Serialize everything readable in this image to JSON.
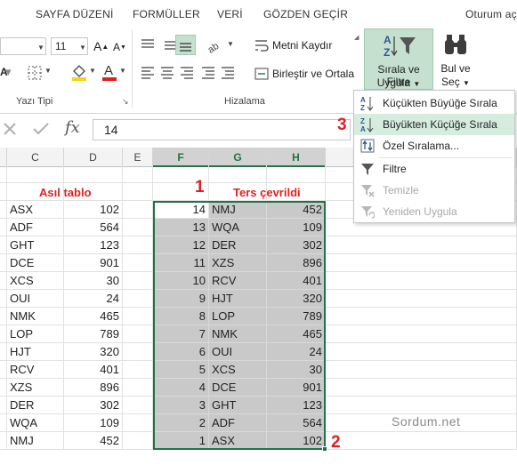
{
  "menu": {
    "tabs": [
      "SAYFA DÜZENİ",
      "FORMÜLLER",
      "VERİ",
      "GÖZDEN GEÇİR"
    ],
    "signin": "Oturum aç"
  },
  "ribbon": {
    "font_size": "11",
    "wrap_text": "Metni Kaydır",
    "merge_center": "Birleştir ve Ortala",
    "sort_filter_line1": "Sırala ve Filtre",
    "sort_filter_line2": "Uygula",
    "find_line1": "Bul ve",
    "find_line2": "Seç",
    "group_font": "Yazı Tipi",
    "group_alignment": "Hizalama"
  },
  "formula": {
    "value": "14",
    "fx": "fx"
  },
  "columns": [
    "C",
    "D",
    "E",
    "F",
    "G",
    "H"
  ],
  "titles": {
    "left": "Asıl tablo",
    "right": "Ters çevrildi"
  },
  "markers": {
    "one": "1",
    "two": "2",
    "three": "3"
  },
  "left_table": [
    {
      "code": "ASX",
      "value": "102"
    },
    {
      "code": "ADF",
      "value": "564"
    },
    {
      "code": "GHT",
      "value": "123"
    },
    {
      "code": "DCE",
      "value": "901"
    },
    {
      "code": "XCS",
      "value": "30"
    },
    {
      "code": "OUI",
      "value": "24"
    },
    {
      "code": "NMK",
      "value": "465"
    },
    {
      "code": "LOP",
      "value": "789"
    },
    {
      "code": "HJT",
      "value": "320"
    },
    {
      "code": "RCV",
      "value": "401"
    },
    {
      "code": "XZS",
      "value": "896"
    },
    {
      "code": "DER",
      "value": "302"
    },
    {
      "code": "WQA",
      "value": "109"
    },
    {
      "code": "NMJ",
      "value": "452"
    }
  ],
  "right_table": [
    {
      "idx": "14",
      "code": "NMJ",
      "value": "452"
    },
    {
      "idx": "13",
      "code": "WQA",
      "value": "109"
    },
    {
      "idx": "12",
      "code": "DER",
      "value": "302"
    },
    {
      "idx": "11",
      "code": "XZS",
      "value": "896"
    },
    {
      "idx": "10",
      "code": "RCV",
      "value": "401"
    },
    {
      "idx": "9",
      "code": "HJT",
      "value": "320"
    },
    {
      "idx": "8",
      "code": "LOP",
      "value": "789"
    },
    {
      "idx": "7",
      "code": "NMK",
      "value": "465"
    },
    {
      "idx": "6",
      "code": "OUI",
      "value": "24"
    },
    {
      "idx": "5",
      "code": "XCS",
      "value": "30"
    },
    {
      "idx": "4",
      "code": "DCE",
      "value": "901"
    },
    {
      "idx": "3",
      "code": "GHT",
      "value": "123"
    },
    {
      "idx": "2",
      "code": "ADF",
      "value": "564"
    },
    {
      "idx": "1",
      "code": "ASX",
      "value": "102"
    }
  ],
  "sort_menu": {
    "asc": "Küçükten Büyüğe Sırala",
    "desc": "Büyükten Küçüğe Sırala",
    "custom": "Özel Sıralama...",
    "filter": "Filtre",
    "clear": "Temizle",
    "reapply": "Yeniden Uygula"
  },
  "watermark": "Sordum.net",
  "colors": {
    "accent_green": "#217346",
    "marker_red": "#e02020",
    "selection_grey": "#c9c9c9",
    "menu_highlight": "#d5ecdf"
  }
}
